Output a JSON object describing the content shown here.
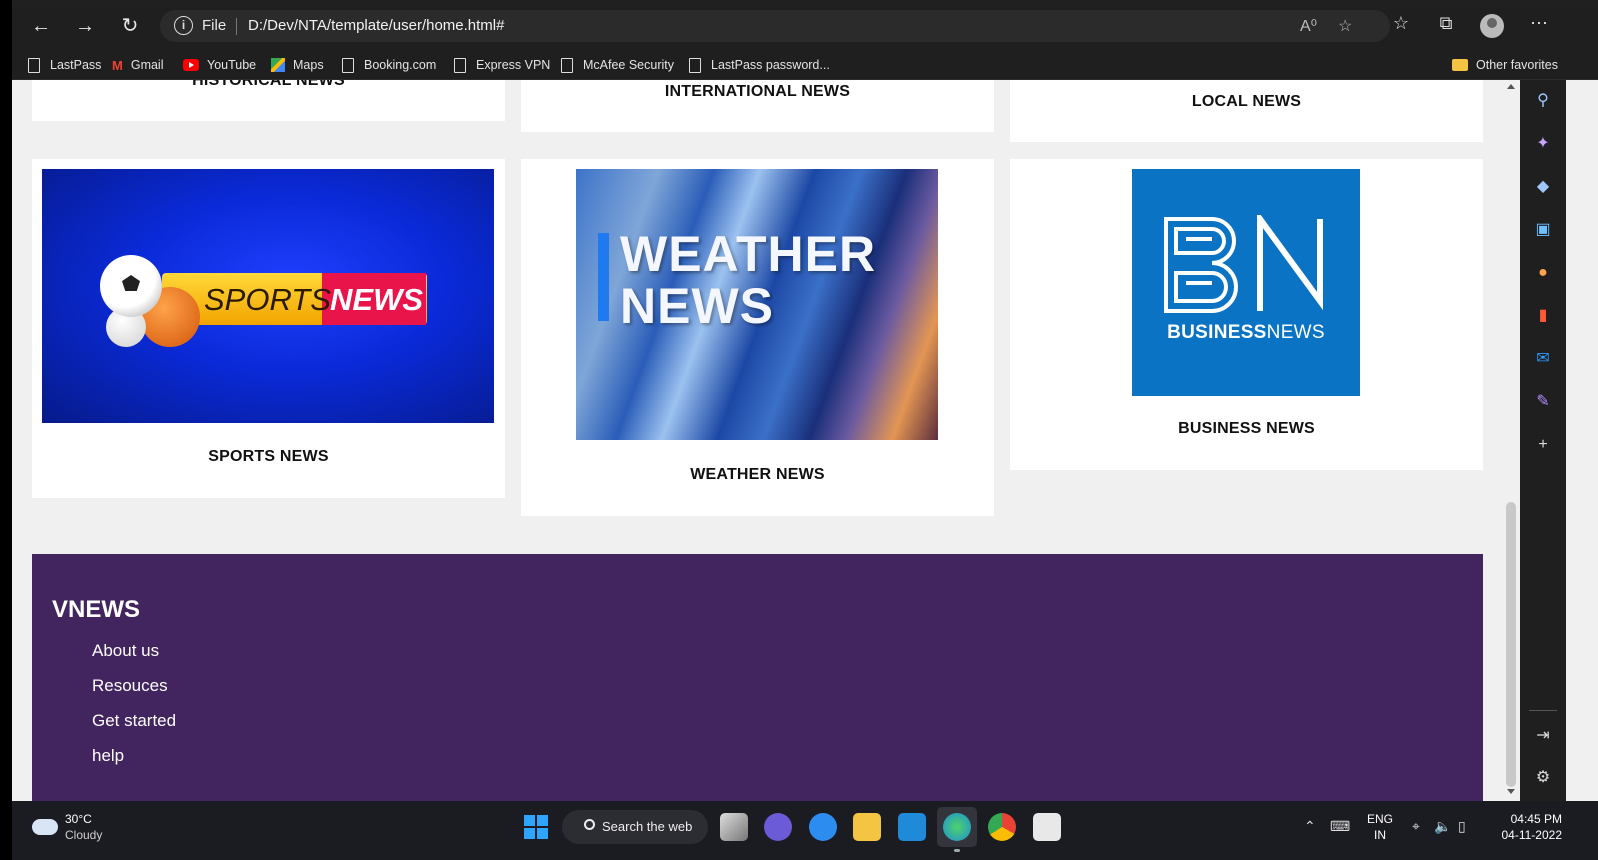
{
  "browser": {
    "address": {
      "scheme_label": "File",
      "url": "D:/Dev/NTA/template/user/home.html#"
    },
    "favorites": [
      {
        "label": "LastPass",
        "icon": "page-icon"
      },
      {
        "label": "Gmail",
        "icon": "gmail-icon"
      },
      {
        "label": "YouTube",
        "icon": "youtube-icon"
      },
      {
        "label": "Maps",
        "icon": "maps-icon"
      },
      {
        "label": "Booking.com",
        "icon": "page-icon"
      },
      {
        "label": "Express VPN",
        "icon": "page-icon"
      },
      {
        "label": "McAfee Security",
        "icon": "page-icon"
      },
      {
        "label": "LastPass password...",
        "icon": "page-icon"
      }
    ],
    "other_favorites": "Other favorites"
  },
  "categories": {
    "historical": "HISTORICAL NEWS",
    "international": "INTERNATIONAL NEWS",
    "local": "LOCAL NEWS",
    "sports": "SPORTS NEWS",
    "weather": "WEATHER NEWS",
    "business": "BUSINESS NEWS"
  },
  "images": {
    "sports": {
      "word1": "SPORTS",
      "word2": "NEWS"
    },
    "weather": {
      "line1": "WEATHER",
      "line2": "NEWS"
    },
    "business": {
      "logo": "BN",
      "word_bold": "BUSINESS",
      "word_light": "NEWS"
    }
  },
  "footer": {
    "brand": "VNEWS",
    "links": [
      "About us",
      "Resouces",
      "Get started",
      "help"
    ]
  },
  "taskbar": {
    "weather_temp": "30°C",
    "weather_desc": "Cloudy",
    "search_label": "Search the web",
    "lang": "ENG",
    "region": "IN",
    "time": "04:45 PM",
    "date": "04-11-2022"
  },
  "colors": {
    "footer_bg": "#42245e",
    "business_blue": "#0a73c4",
    "browser_chrome": "#1f1f1f"
  }
}
